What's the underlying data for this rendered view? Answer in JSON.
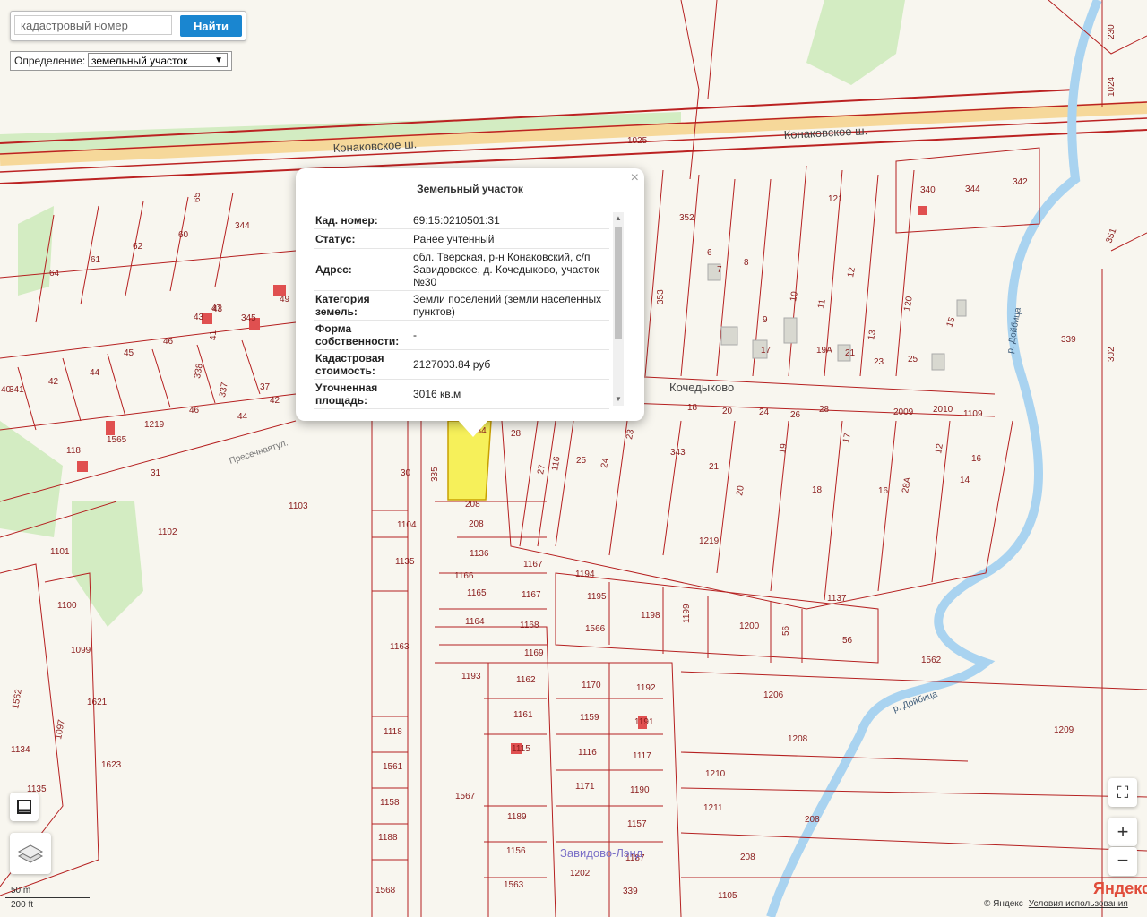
{
  "search": {
    "placeholder": "кадастровый номер",
    "button_label": "Найти"
  },
  "definition": {
    "label": "Определение:",
    "selected": "земельный участок",
    "arrow": "▼"
  },
  "popup": {
    "title": "Земельный участок",
    "close": "×",
    "rows": [
      {
        "key": "Кад. номер:",
        "value": "69:15:0210501:31"
      },
      {
        "key": "Статус:",
        "value": "Ранее учтенный"
      },
      {
        "key": "Адрес:",
        "value": "обл. Тверская, р-н Конаковский, с/п Завидовское, д. Кочедыково, участок №30"
      },
      {
        "key": "Категория земель:",
        "value": "Земли поселений (земли населенных пунктов)"
      },
      {
        "key": "Форма собственности:",
        "value": "-"
      },
      {
        "key": "Кадастровая стоимость:",
        "value": "2127003.84 руб"
      },
      {
        "key": "Уточненная площадь:",
        "value": "3016 кв.м"
      }
    ]
  },
  "map": {
    "roads": {
      "highway_left": "Конаковское ш.",
      "highway_right": "Конаковское ш.",
      "highway_num": "1025",
      "village": "Кочедыково",
      "street": "Пресечнаятул.",
      "settlement": "Завидово-Лэнд"
    },
    "rivers": {
      "river_1": "р. Дойбица",
      "river_2": "р. Дойбица"
    },
    "parcels": [
      "230",
      "1024",
      "351",
      "340",
      "344",
      "342",
      "121",
      "352",
      "6",
      "7",
      "8",
      "9",
      "10",
      "11",
      "12",
      "13",
      "120",
      "15",
      "339",
      "302",
      "353",
      "17",
      "19А",
      "21",
      "23",
      "25",
      "64",
      "61",
      "62",
      "60",
      "65",
      "344",
      "47",
      "43",
      "345",
      "49",
      "45",
      "46",
      "43",
      "44",
      "341",
      "42",
      "41",
      "40",
      "338",
      "337",
      "37",
      "42",
      "44",
      "46",
      "118",
      "1565",
      "1219",
      "31",
      "30",
      "335",
      "334",
      "28",
      "27",
      "116",
      "25",
      "24",
      "23",
      "343",
      "21",
      "20",
      "19",
      "18",
      "17",
      "16",
      "28А",
      "12",
      "14",
      "16",
      "18",
      "20",
      "24",
      "26",
      "28",
      "2009",
      "2010",
      "1109",
      "208",
      "208",
      "1104",
      "1103",
      "1102",
      "1101",
      "1100",
      "1099",
      "1621",
      "1623",
      "1097",
      "1562",
      "1134",
      "1135",
      "1135",
      "1136",
      "1166",
      "1165",
      "1164",
      "1167",
      "1167",
      "1168",
      "1194",
      "1195",
      "1566",
      "1198",
      "1199",
      "1200",
      "56",
      "56",
      "1562",
      "1219",
      "1137",
      "1163",
      "1169",
      "1193",
      "1162",
      "1170",
      "1192",
      "1161",
      "1159",
      "1191",
      "1115",
      "1116",
      "1117",
      "1118",
      "1561",
      "1567",
      "1171",
      "1190",
      "1158",
      "1189",
      "1157",
      "1188",
      "1156",
      "1187",
      "1568",
      "1202",
      "1563",
      "339",
      "1206",
      "1208",
      "1209",
      "1210",
      "1211",
      "208",
      "208",
      "1105"
    ]
  },
  "controls": {
    "zoom_in": "+",
    "zoom_out": "−",
    "fullscreen": "⛶",
    "ruler_icon": "ruler-icon",
    "layers_icon": "layers-icon"
  },
  "scale": {
    "metric": "50 m",
    "imperial": "200 ft"
  },
  "logo": "Яндекс",
  "copyright": {
    "text": "© Яндекс",
    "terms": "Условия использования"
  }
}
